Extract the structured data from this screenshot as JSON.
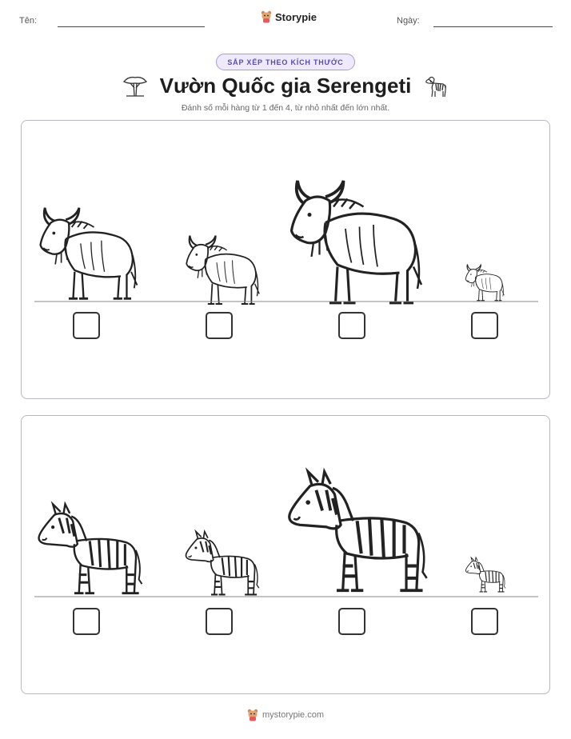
{
  "header": {
    "name_label": "Tên:",
    "date_label": "Ngày:",
    "brand": "Storypie"
  },
  "badge": "SẮP XẾP THEO KÍCH THƯỚC",
  "title": "Vườn Quốc gia Serengeti",
  "instructions": "Đánh số mỗi hàng từ 1 đến 4, từ nhỏ nhất đến lớn nhất.",
  "icons": {
    "title_left": "acacia-tree-icon",
    "title_right": "zebra-icon",
    "brand": "bear-mascot-icon"
  },
  "rows": [
    {
      "animal": "wildebeest",
      "relative_sizes": [
        0.75,
        0.52,
        1.0,
        0.3
      ],
      "answer_boxes": [
        "",
        "",
        "",
        ""
      ]
    },
    {
      "animal": "zebra",
      "relative_sizes": [
        0.75,
        0.52,
        1.0,
        0.3
      ],
      "answer_boxes": [
        "",
        "",
        "",
        ""
      ]
    }
  ],
  "footer": "mystorypie.com"
}
